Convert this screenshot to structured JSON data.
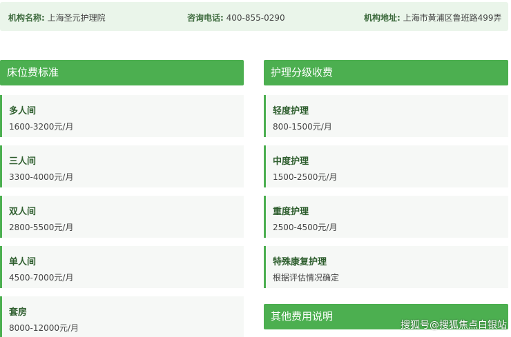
{
  "header": {
    "name_label": "机构名称:",
    "name_value": "上海圣元护理院",
    "phone_label": "咨询电话:",
    "phone_value": "400-855-0290",
    "address_label": "机构地址:",
    "address_value": "上海市黄浦区鲁班路499弄"
  },
  "bed_fees": {
    "title": "床位费标准",
    "items": [
      {
        "name": "多人间",
        "price": "1600-3200元/月"
      },
      {
        "name": "三人间",
        "price": "3300-4000元/月"
      },
      {
        "name": "双人间",
        "price": "2800-5500元/月"
      },
      {
        "name": "单人间",
        "price": "4500-7000元/月"
      },
      {
        "name": "套房",
        "price": "8000-12000元/月"
      }
    ]
  },
  "care_fees": {
    "title": "护理分级收费",
    "items": [
      {
        "name": "轻度护理",
        "price": "800-1500元/月"
      },
      {
        "name": "中度护理",
        "price": "1500-2500元/月"
      },
      {
        "name": "重度护理",
        "price": "2500-4500元/月"
      },
      {
        "name": "特殊康复护理",
        "price": "根据评估情况确定"
      }
    ]
  },
  "other_fees": {
    "title": "其他费用说明"
  },
  "watermark": "搜狐号@搜狐焦点白银站",
  "colors": {
    "accent": "#4caf50",
    "info_bg": "#eaf5ea",
    "card_bg": "#f6f8f6"
  }
}
